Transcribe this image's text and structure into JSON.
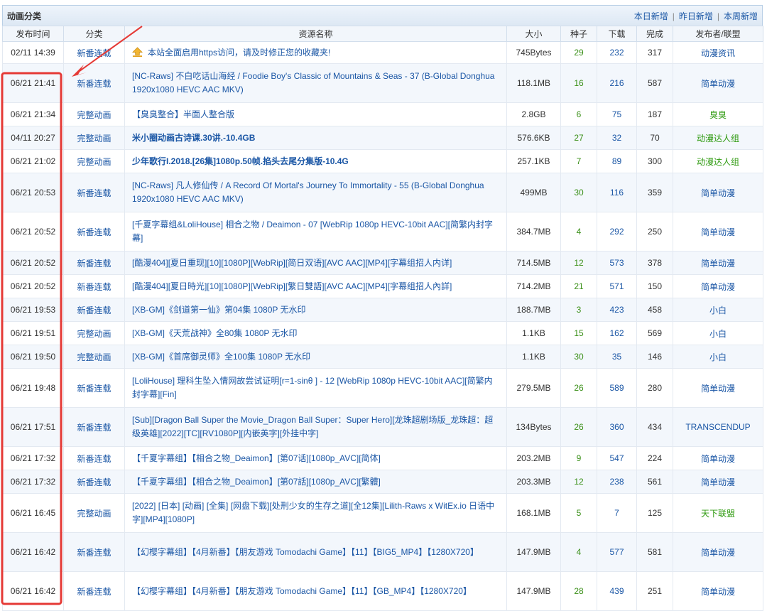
{
  "header": {
    "title": "动画分类",
    "links": [
      "本日新增",
      "昨日新增",
      "本周新增"
    ]
  },
  "columns": [
    "发布时间",
    "分类",
    "资源名称",
    "大小",
    "种子",
    "下载",
    "完成",
    "发布者/联盟"
  ],
  "colors": {
    "link": "#1a56a5",
    "seed": "#3a8f18",
    "publisher_green": "#2e9a0f",
    "highlight_border": "#e53935",
    "arrow": "#e53935"
  },
  "rows": [
    {
      "time": "02/11 14:39",
      "category": "新番连载",
      "title": "本站全面启用https访问，请及时修正您的收藏夹!",
      "size": "745Bytes",
      "seeds": "29",
      "downloads": "232",
      "completed": "317",
      "publisher": "动漫资讯",
      "pub_color": "#1a56a5",
      "notice": true,
      "bold": false,
      "height": 31
    },
    {
      "time": "06/21 21:41",
      "category": "新番连载",
      "title": "[NC-Raws] 不白吃话山海经 / Foodie Boy's Classic of Mountains & Seas - 37 (B-Global Donghua 1920x1080 HEVC AAC MKV)",
      "size": "118.1MB",
      "seeds": "16",
      "downloads": "216",
      "completed": "587",
      "publisher": "简单动漫",
      "pub_color": "#1a56a5",
      "notice": false,
      "bold": false,
      "height": 55
    },
    {
      "time": "06/21 21:34",
      "category": "完整动画",
      "title": "【臭臭整合】半面人整合版",
      "size": "2.8GB",
      "seeds": "6",
      "downloads": "75",
      "completed": "187",
      "publisher": "臭臭",
      "pub_color": "#2e9a0f",
      "notice": false,
      "bold": false,
      "height": 33
    },
    {
      "time": "04/11 20:27",
      "category": "完整动画",
      "title": "米小圈动画古诗课.30讲.-10.4GB",
      "size": "576.6KB",
      "seeds": "27",
      "downloads": "32",
      "completed": "70",
      "publisher": "动漫达人组",
      "pub_color": "#2e9a0f",
      "notice": false,
      "bold": true,
      "height": 33
    },
    {
      "time": "06/21 21:02",
      "category": "完整动画",
      "title": "少年歌行I.2018.[26集]1080p.50帧.掐头去尾分集版-10.4G",
      "size": "257.1KB",
      "seeds": "7",
      "downloads": "89",
      "completed": "300",
      "publisher": "动漫达人组",
      "pub_color": "#2e9a0f",
      "notice": false,
      "bold": true,
      "height": 33
    },
    {
      "time": "06/21 20:53",
      "category": "新番连载",
      "title": "[NC-Raws] 凡人修仙传 / A Record Of Mortal's Journey To Immortality - 55 (B-Global Donghua 1920x1080 HEVC AAC MKV)",
      "size": "499MB",
      "seeds": "30",
      "downloads": "116",
      "completed": "359",
      "publisher": "简单动漫",
      "pub_color": "#1a56a5",
      "notice": false,
      "bold": false,
      "height": 55
    },
    {
      "time": "06/21 20:52",
      "category": "新番连载",
      "title": "[千夏字幕组&LoliHouse] 相合之物 / Deaimon - 07 [WebRip 1080p HEVC-10bit AAC][简繁内封字幕]",
      "size": "384.7MB",
      "seeds": "4",
      "downloads": "292",
      "completed": "250",
      "publisher": "简单动漫",
      "pub_color": "#1a56a5",
      "notice": false,
      "bold": false,
      "height": 55
    },
    {
      "time": "06/21 20:52",
      "category": "新番连载",
      "title": "[酷漫404][夏日重现][10][1080P][WebRip][简日双语][AVC AAC][MP4][字幕组招人内详]",
      "size": "714.5MB",
      "seeds": "12",
      "downloads": "573",
      "completed": "378",
      "publisher": "简单动漫",
      "pub_color": "#1a56a5",
      "notice": false,
      "bold": false,
      "height": 33
    },
    {
      "time": "06/21 20:52",
      "category": "新番连载",
      "title": "[酷漫404][夏日時光][10][1080P][WebRip][繁日雙語][AVC AAC][MP4][字幕组招人內詳]",
      "size": "714.2MB",
      "seeds": "21",
      "downloads": "571",
      "completed": "150",
      "publisher": "简单动漫",
      "pub_color": "#1a56a5",
      "notice": false,
      "bold": false,
      "height": 33
    },
    {
      "time": "06/21 19:53",
      "category": "新番连载",
      "title": "[XB-GM]《剑道第一仙》第04集 1080P 无水印",
      "size": "188.7MB",
      "seeds": "3",
      "downloads": "423",
      "completed": "458",
      "publisher": "小白",
      "pub_color": "#1a56a5",
      "notice": false,
      "bold": false,
      "height": 33
    },
    {
      "time": "06/21 19:51",
      "category": "完整动画",
      "title": "[XB-GM]《天荒战神》全80集 1080P 无水印",
      "size": "1.1KB",
      "seeds": "15",
      "downloads": "162",
      "completed": "569",
      "publisher": "小白",
      "pub_color": "#1a56a5",
      "notice": false,
      "bold": false,
      "height": 33
    },
    {
      "time": "06/21 19:50",
      "category": "完整动画",
      "title": "[XB-GM]《首席御灵师》全100集 1080P 无水印",
      "size": "1.1KB",
      "seeds": "30",
      "downloads": "35",
      "completed": "146",
      "publisher": "小白",
      "pub_color": "#1a56a5",
      "notice": false,
      "bold": false,
      "height": 33
    },
    {
      "time": "06/21 19:48",
      "category": "新番连载",
      "title": "[LoliHouse] 理科生坠入情网故尝试证明[r=1-sinθ ] - 12 [WebRip 1080p HEVC-10bit AAC][简繁内封字幕][Fin]",
      "size": "279.5MB",
      "seeds": "26",
      "downloads": "589",
      "completed": "280",
      "publisher": "简单动漫",
      "pub_color": "#1a56a5",
      "notice": false,
      "bold": false,
      "height": 55
    },
    {
      "time": "06/21 17:51",
      "category": "新番连载",
      "title": "[Sub][Dragon Ball Super the Movie_Dragon Ball Super：Super Hero][龙珠超剧场版_龙珠超：超级英雄][2022][TC][RV1080P][内嵌英字][外挂中字]",
      "size": "134Bytes",
      "seeds": "26",
      "downloads": "360",
      "completed": "434",
      "publisher": "TRANSCENDUP",
      "pub_color": "#1a56a5",
      "notice": false,
      "bold": false,
      "height": 55
    },
    {
      "time": "06/21 17:32",
      "category": "新番连载",
      "title": "【千夏字幕组】【相合之物_Deaimon】[第07话][1080p_AVC][简体]",
      "size": "203.2MB",
      "seeds": "9",
      "downloads": "547",
      "completed": "224",
      "publisher": "简单动漫",
      "pub_color": "#1a56a5",
      "notice": false,
      "bold": false,
      "height": 33
    },
    {
      "time": "06/21 17:32",
      "category": "新番连载",
      "title": "【千夏字幕组】【相合之物_Deaimon】[第07話][1080p_AVC][繁體]",
      "size": "203.3MB",
      "seeds": "12",
      "downloads": "238",
      "completed": "561",
      "publisher": "简单动漫",
      "pub_color": "#1a56a5",
      "notice": false,
      "bold": false,
      "height": 33
    },
    {
      "time": "06/21 16:45",
      "category": "完整动画",
      "title": "[2022] [日本] [动画] [全集] [网盘下载][处刑少女的生存之道][全12集][Lilith-Raws x WitEx.io 日语中字][MP4][1080P]",
      "size": "168.1MB",
      "seeds": "5",
      "downloads": "7",
      "completed": "125",
      "publisher": "天下联盟",
      "pub_color": "#2e9a0f",
      "notice": false,
      "bold": false,
      "height": 55
    },
    {
      "time": "06/21 16:42",
      "category": "新番连载",
      "title": "【幻樱字幕组】【4月新番】【朋友游戏 Tomodachi Game】【11】【BIG5_MP4】【1280X720】",
      "size": "147.9MB",
      "seeds": "4",
      "downloads": "577",
      "completed": "581",
      "publisher": "简单动漫",
      "pub_color": "#1a56a5",
      "notice": false,
      "bold": false,
      "height": 55
    },
    {
      "time": "06/21 16:42",
      "category": "新番连载",
      "title": "【幻樱字幕组】【4月新番】【朋友游戏 Tomodachi Game】【11】【GB_MP4】【1280X720】",
      "size": "147.9MB",
      "seeds": "28",
      "downloads": "439",
      "completed": "251",
      "publisher": "简单动漫",
      "pub_color": "#1a56a5",
      "notice": false,
      "bold": false,
      "height": 55
    }
  ]
}
